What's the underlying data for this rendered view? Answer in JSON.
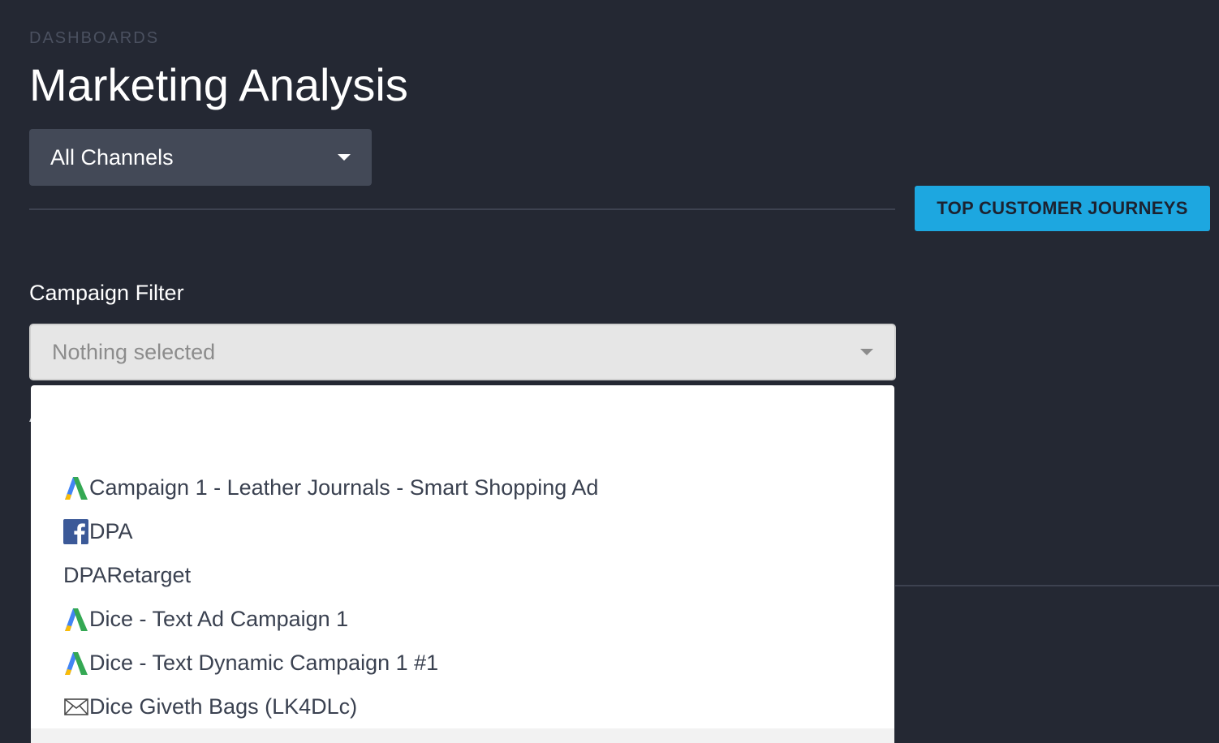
{
  "header": {
    "breadcrumb": "DASHBOARDS",
    "title": "Marketing Analysis"
  },
  "channel_select": {
    "value": "All Channels"
  },
  "actions": {
    "journeys_label": "TOP CUSTOMER JOURNEYS"
  },
  "campaign_filter": {
    "label": "Campaign Filter",
    "placeholder": "Nothing selected",
    "items": [
      {
        "label": "Campaign 1 - Leather Journals - Smart Shopping Ad",
        "icon": "google-ads-icon"
      },
      {
        "label": "DPA",
        "icon": "facebook-icon"
      },
      {
        "label": "DPARetarget",
        "icon": ""
      },
      {
        "label": "Dice - Text Ad Campaign 1",
        "icon": "google-ads-icon"
      },
      {
        "label": "Dice - Text Dynamic Campaign 1 #1",
        "icon": "google-ads-icon"
      },
      {
        "label": "Dice Giveth Bags (LK4DLc)",
        "icon": "email-icon"
      }
    ]
  },
  "colors": {
    "background": "#242833",
    "accent": "#1da7e0",
    "select_bg": "#434957"
  }
}
